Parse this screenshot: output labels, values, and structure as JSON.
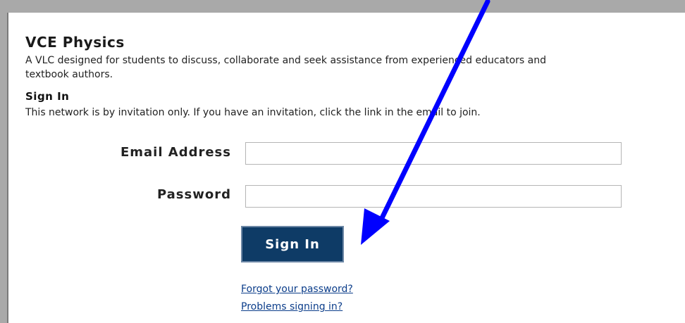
{
  "header": {
    "title": "VCE Physics",
    "description": "A VLC designed for students to discuss, collaborate and seek assistance from experienced educators and textbook authors."
  },
  "signin": {
    "heading": "Sign In",
    "notice": "This network is by invitation only. If you have an invitation, click the link in the email to join.",
    "email_label": "Email Address",
    "email_value": "",
    "email_placeholder": "",
    "password_label": "Password",
    "password_value": "",
    "password_placeholder": "",
    "button_label": "Sign In",
    "forgot_link": "Forgot your password?",
    "problems_link": "Problems signing in?"
  },
  "colors": {
    "background": "#a9a9a9",
    "button": "#0e3b66",
    "link": "#0b3d8a",
    "arrow": "#0000ff"
  },
  "icons": {
    "annotation": "pointer-arrow-icon"
  }
}
